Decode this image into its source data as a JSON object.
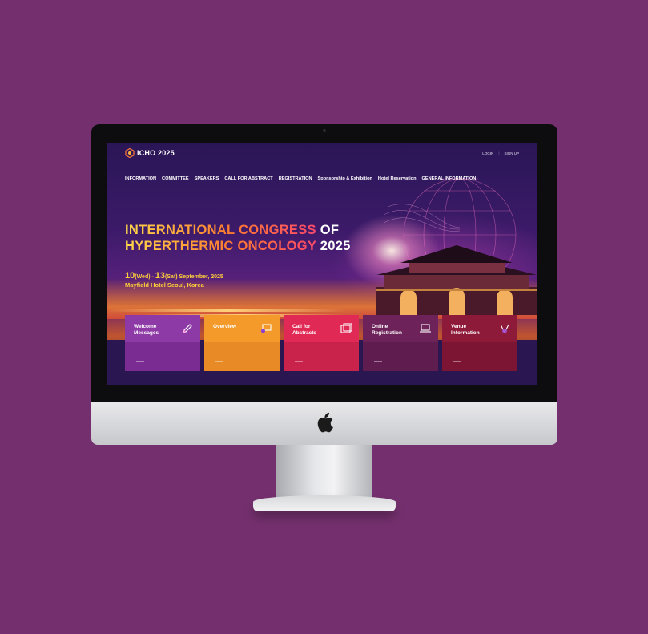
{
  "site": {
    "logo_text": "ICHO 2025",
    "auth": {
      "login": "LOGIN",
      "signup": "SIGN UP"
    },
    "nav": [
      "INFORMATION",
      "COMMITTEE",
      "SPEAKERS",
      "CALL FOR ABSTRACT",
      "REGISTRATION",
      "Sponsorship & Exhibition",
      "Hotel Reservation",
      "GENERAL INFORMATION"
    ],
    "hero": {
      "title_line1_a": "INTERNATIONAL CONGRESS",
      "title_line1_b": " OF",
      "title_line2_a": "HYPERTHERMIC ONCOLOGY",
      "title_line2_b": " 2025",
      "date_big_1": "10",
      "date_small_1": "(Wed) - ",
      "date_big_2": "13",
      "date_small_2": "(Sat) September, 2025",
      "venue": "Mayfield Hotel Seoul, Korea"
    },
    "cards": [
      {
        "label_1": "Welcome",
        "label_2": "Messages",
        "icon": "pencil-icon",
        "color_top": "#8e3aa6",
        "color_bottom": "#7a2c92"
      },
      {
        "label_1": "Overview",
        "label_2": "",
        "icon": "chat-icon",
        "color_top": "#f39a2b",
        "color_bottom": "#e88a26"
      },
      {
        "label_1": "Call for",
        "label_2": "Abstracts",
        "icon": "document-icon",
        "color_top": "#e02a55",
        "color_bottom": "#c9224b"
      },
      {
        "label_1": "Online",
        "label_2": "Registration",
        "icon": "laptop-icon",
        "color_top": "#6d2259",
        "color_bottom": "#5e1c4f"
      },
      {
        "label_1": "Venue",
        "label_2": "Information",
        "icon": "location-icon",
        "color_top": "#8e1a3a",
        "color_bottom": "#7c1533"
      }
    ]
  },
  "colors": {
    "background": "#74306e",
    "accent": "#ffcf3a"
  }
}
